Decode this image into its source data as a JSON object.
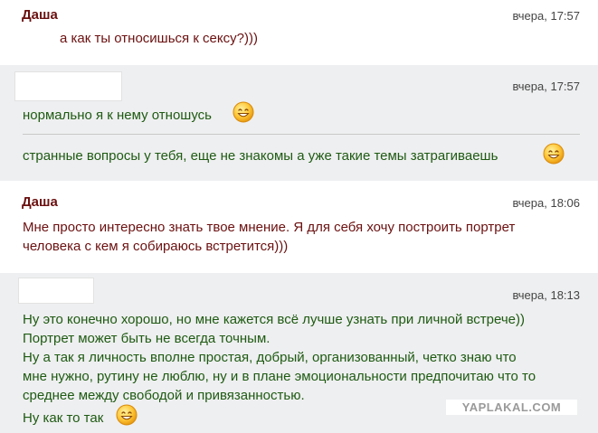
{
  "messages": [
    {
      "sender": "Даша",
      "time": "вчера, 17:57",
      "lines": [
        "а как ты относишься к сексу?)))"
      ]
    },
    {
      "sender": "",
      "time": "вчера, 17:57",
      "part1": [
        "нормально я к нему отношусь"
      ],
      "part2": [
        "странные вопросы у тебя, еще не знакомы а уже такие темы затрагиваешь"
      ]
    },
    {
      "sender": "Даша",
      "time": "вчера, 18:06",
      "lines": [
        "Мне просто интересно знать твое мнение. Я для себя хочу построить портрет",
        "человека с кем я собираюсь встретится)))"
      ]
    },
    {
      "sender": "",
      "time": "вчера, 18:13",
      "lines": [
        "Ну это конечно хорошо, но мне кажется всё лучше узнать при личной встрече))",
        "Портрет может быть не всегда точным.",
        "Ну а так я личность вполне простая, добрый, организованный, четко знаю что",
        "мне нужно, рутину не люблю, ну и в плане эмоциональности предпочитаю что то",
        "среднее между свободой и привязанностью.",
        "Ну как то так"
      ]
    }
  ],
  "watermark": "YAPLAKAL.COM",
  "icons": {
    "smiley": "smiley-icon"
  },
  "colors": {
    "sender": "#6b1010",
    "her_text": "#6b1010",
    "his_text": "#1e5a12",
    "grey_bg": "#eeeff0",
    "smiley_face": "#ffc83a"
  }
}
